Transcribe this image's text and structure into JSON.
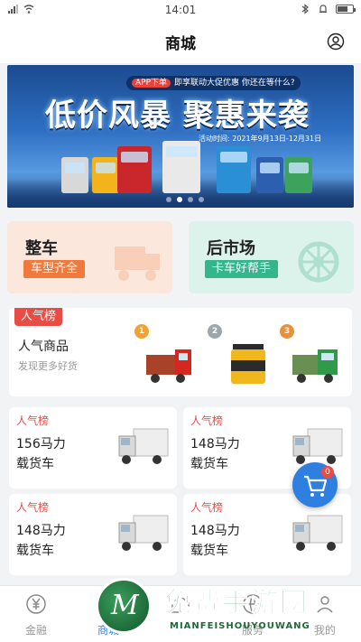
{
  "status_bar": {
    "time": "14:01"
  },
  "header": {
    "title": "商城",
    "user_icon": "user-circle-icon"
  },
  "banner": {
    "app_tag": "APP下单",
    "promo_text": "即享联动大促优惠  你还在等什么?",
    "headline": "低价风暴 聚惠来袭",
    "date_text": "活动时间: 2021年9月13日-12月31日",
    "slide_count": 4,
    "active_slide": 2
  },
  "categories": [
    {
      "name": "整车",
      "tag": "车型齐全",
      "color": "#f07a3e"
    },
    {
      "name": "后市场",
      "tag": "卡车好帮手",
      "color": "#34b58b"
    }
  ],
  "popular": {
    "flag": "人气榜",
    "title": "人气商品",
    "subtitle": "发现更多好货",
    "products": [
      {
        "rank": "1",
        "icon": "red-truck-icon"
      },
      {
        "rank": "2",
        "icon": "oil-bucket-icon"
      },
      {
        "rank": "3",
        "icon": "green-truck-icon"
      }
    ]
  },
  "cards": [
    {
      "label": "人气榜",
      "line1": "156马力",
      "line2": "载货车"
    },
    {
      "label": "人气榜",
      "line1": "148马力",
      "line2": "载货车"
    },
    {
      "label": "人气榜",
      "line1": "148马力",
      "line2": "载货车"
    },
    {
      "label": "人气榜",
      "line1": "148马力",
      "line2": "载货车"
    }
  ],
  "cart": {
    "badge": "0"
  },
  "tabbar": {
    "items": [
      {
        "label": "金融",
        "icon": "yuan-icon"
      },
      {
        "label": "商城",
        "icon": "shop-icon"
      },
      {
        "label": "",
        "icon": "home-icon"
      },
      {
        "label": "服务",
        "icon": "service-icon"
      },
      {
        "label": "我的",
        "icon": "profile-icon"
      }
    ]
  },
  "watermark": {
    "cn": "免费手游网",
    "en": "MIANFEISHOUYOUWANG",
    "logo_letter": "M"
  }
}
